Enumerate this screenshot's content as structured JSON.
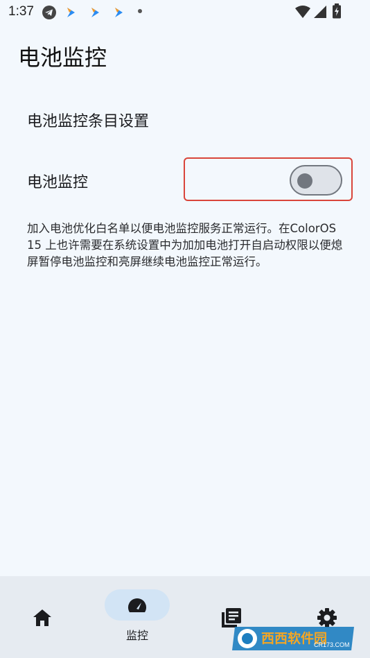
{
  "status_bar": {
    "time": "1:37",
    "icons": [
      "telegram-icon",
      "app-arrow-icon",
      "app-arrow-icon",
      "app-arrow-icon",
      "dot-icon",
      "wifi-icon",
      "signal-icon",
      "battery-charging-icon"
    ]
  },
  "page": {
    "title": "电池监控"
  },
  "settings": {
    "item_config_label": "电池监控条目设置",
    "monitor_label": "电池监控",
    "monitor_enabled": false,
    "description": "加入电池优化白名单以便电池监控服务正常运行。在ColorOS 15 上也许需要在系统设置中为加加电池打开自启动权限以便熄屏暂停电池监控和亮屏继续电池监控正常运行。"
  },
  "bottom_nav": {
    "items": [
      {
        "icon": "home-icon",
        "label": ""
      },
      {
        "icon": "speedometer-icon",
        "label": "监控",
        "selected": true
      },
      {
        "icon": "library-icon",
        "label": ""
      },
      {
        "icon": "settings-gear-icon",
        "label": ""
      }
    ]
  },
  "colors": {
    "background": "#f3f8fd",
    "nav_background": "#e6ebf1",
    "nav_selected_pill": "#d2e4f5",
    "highlight_border": "#d9453a"
  },
  "watermark": {
    "text": "西西软件园",
    "subtext": "CR173.COM"
  }
}
